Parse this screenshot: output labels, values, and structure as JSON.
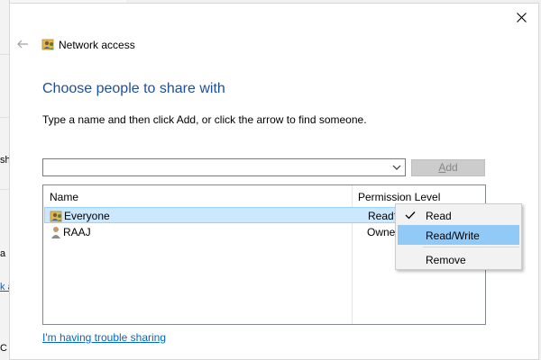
{
  "background": {
    "side_texts": [
      "sh",
      "a",
      "k a",
      "C"
    ]
  },
  "dialog": {
    "title": "Network access",
    "heading": "Choose people to share with",
    "instructions": "Type a name and then click Add, or click the arrow to find someone.",
    "name_input": {
      "value": "",
      "placeholder": ""
    },
    "add_button": {
      "label_underlined": "A",
      "label_rest": "dd"
    },
    "list": {
      "columns": [
        "Name",
        "Permission Level"
      ],
      "rows": [
        {
          "name": "Everyone",
          "permission": "Read",
          "icon": "group-users-icon",
          "selected": true
        },
        {
          "name": "RAAJ",
          "permission": "Owner",
          "icon": "user-icon",
          "selected": false
        }
      ]
    },
    "trouble_link": "I'm having trouble sharing"
  },
  "permission_menu": {
    "items": [
      {
        "label": "Read",
        "checked": true
      },
      {
        "label": "Read/Write",
        "highlighted": true
      },
      {
        "label": "Remove"
      }
    ]
  },
  "colors": {
    "heading": "#1f4e99",
    "link": "#0066cc",
    "selection": "#cce8ff",
    "menu_highlight": "#91c9f7"
  }
}
